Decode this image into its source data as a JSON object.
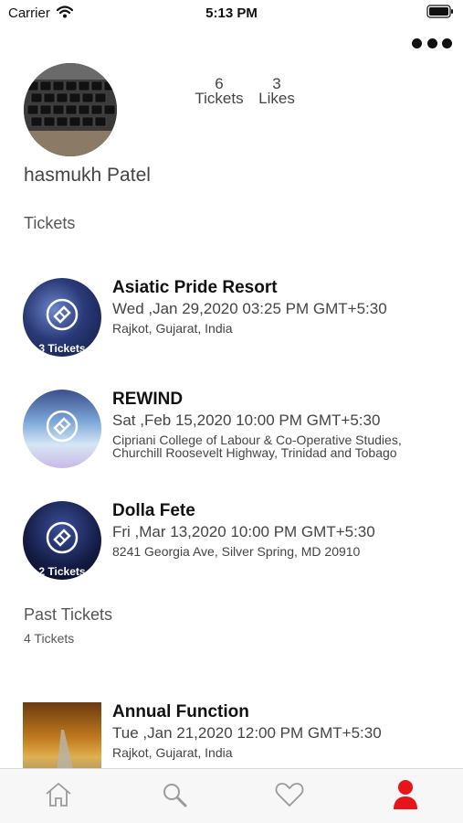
{
  "status_bar": {
    "carrier": "Carrier",
    "time": "5:13 PM"
  },
  "profile": {
    "name": "hasmukh Patel",
    "tickets_count": "6",
    "tickets_label": "Tickets",
    "likes_count": "3",
    "likes_label": "Likes"
  },
  "sections": {
    "tickets_title": "Tickets",
    "past_title": "Past Tickets",
    "past_count": "4 Tickets"
  },
  "tickets": [
    {
      "title": "Asiatic Pride Resort",
      "date": "Wed ,Jan 29,2020 03:25 PM GMT+5:30",
      "venue": "Rajkot, Gujarat, India",
      "badge": "3 Tickets"
    },
    {
      "title": "REWIND",
      "date": "Sat ,Feb 15,2020 10:00 PM GMT+5:30",
      "venue": "Cipriani College of Labour & Co-Operative Studies, Churchill Roosevelt Highway, Trinidad and Tobago",
      "badge": ""
    },
    {
      "title": "Dolla Fete",
      "date": "Fri ,Mar 13,2020 10:00 PM GMT+5:30",
      "venue": "8241 Georgia Ave, Silver Spring, MD 20910",
      "badge": "2 Tickets"
    }
  ],
  "past_tickets": [
    {
      "title": "Annual Function",
      "date": "Tue ,Jan 21,2020 12:00 PM GMT+5:30",
      "venue": "Rajkot, Gujarat, India"
    }
  ],
  "tab_bar": {
    "items": [
      "home-icon",
      "search-icon",
      "heart-icon",
      "profile-icon"
    ],
    "active": "profile-icon",
    "active_color": "#e8141b",
    "inactive_color": "#9a9a9a"
  }
}
